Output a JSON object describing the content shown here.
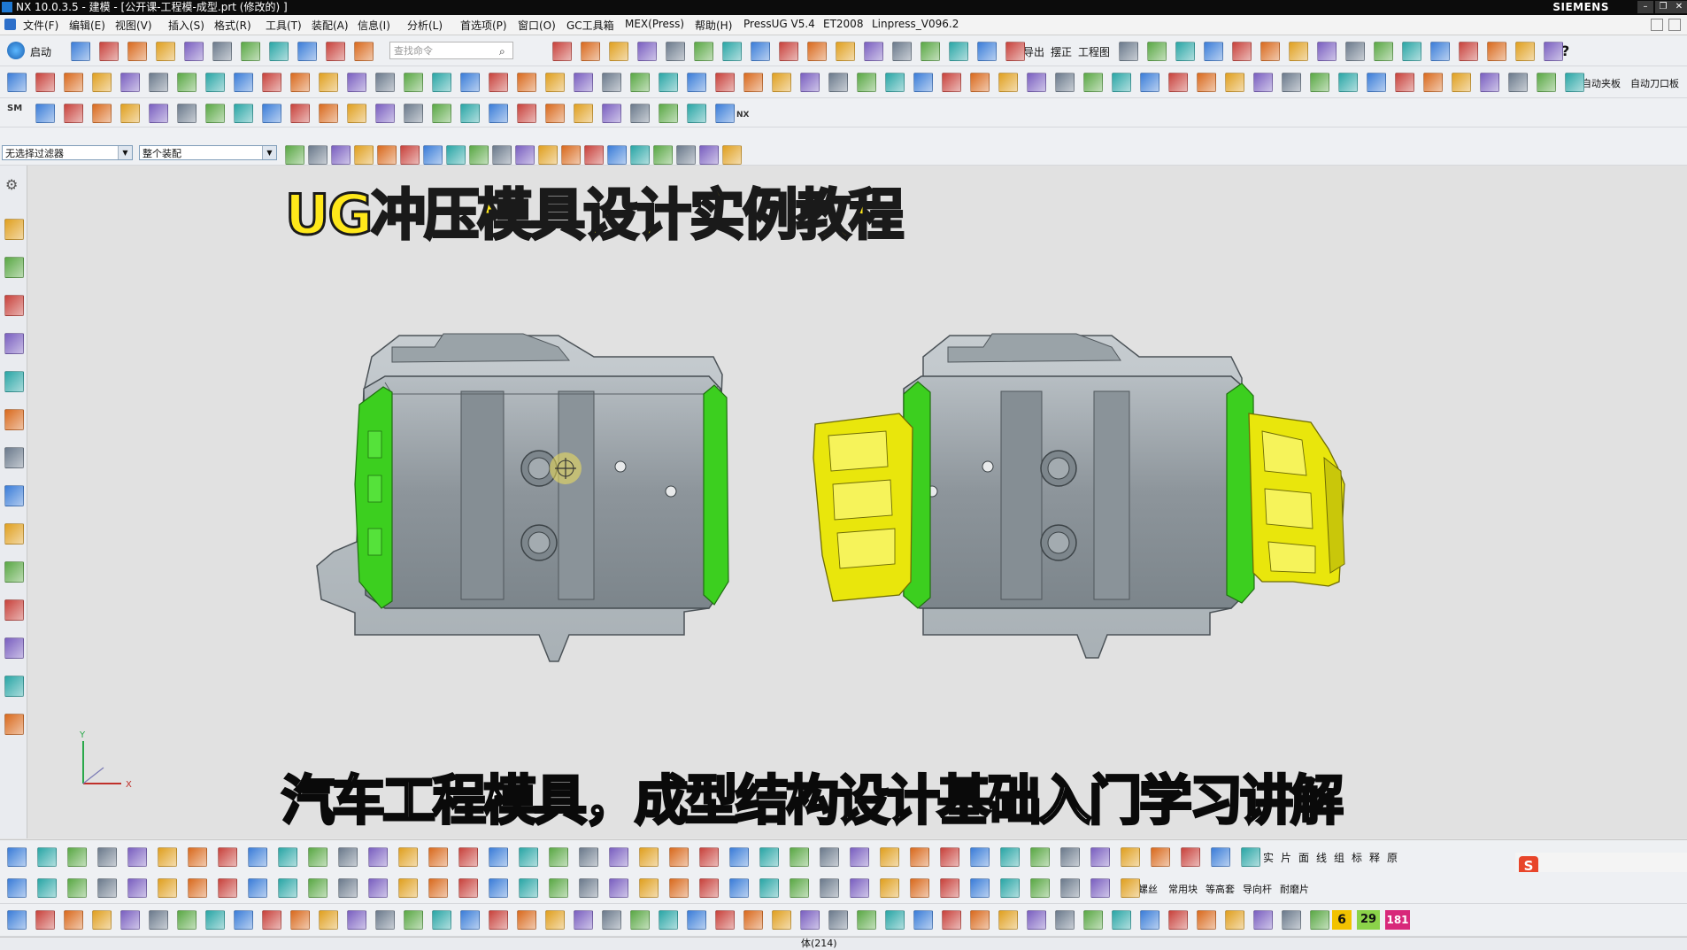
{
  "window": {
    "title": "NX 10.0.3.5 - 建模 - [公开课-工程模-成型.prt  (修改的) ]",
    "brand": "SIEMENS",
    "controls": [
      "–",
      "❐",
      "✕"
    ]
  },
  "menu": {
    "items": [
      "文件(F)",
      "编辑(E)",
      "视图(V)",
      "插入(S)",
      "格式(R)",
      "工具(T)",
      "装配(A)",
      "信息(I)",
      "分析(L)",
      "首选项(P)",
      "窗口(O)",
      "GC工具箱",
      "MEX(Press)",
      "帮助(H)",
      "PressUG V5.4",
      "ET2008",
      "Linpress_V096.2"
    ]
  },
  "toolbar1": {
    "start_label": "启动",
    "search_placeholder": "查找命令",
    "text_items": [
      "导出",
      "摆正",
      "工程图"
    ]
  },
  "toolbar2": {
    "text_items": [
      "自动夹板",
      "自动刀口板"
    ]
  },
  "filter_bar": {
    "selection_filter": "无选择过滤器",
    "scope": "整个装配"
  },
  "overlay": {
    "title": "UG冲压模具设计实例教程",
    "subtitle": "汽车工程模具，成型结构设计基础入门学习讲解"
  },
  "bottom_toolbar": {
    "text_items": [
      "实",
      "片",
      "面",
      "线",
      "组",
      "标",
      "释",
      "原"
    ],
    "text_items2": [
      "螺丝",
      "常用块",
      "等高套",
      "导向杆",
      "耐磨片"
    ],
    "numbers": [
      "6",
      "29",
      "181"
    ]
  },
  "status": {
    "text": "体(214)"
  },
  "axis": {
    "x_label": "X",
    "y_label": "Y"
  },
  "colors": {
    "title_yellow": "#ffe81a",
    "part_gray": "#9aa1a6",
    "flange_green": "#3ccf1f",
    "flange_yellow": "#e9e60c"
  }
}
